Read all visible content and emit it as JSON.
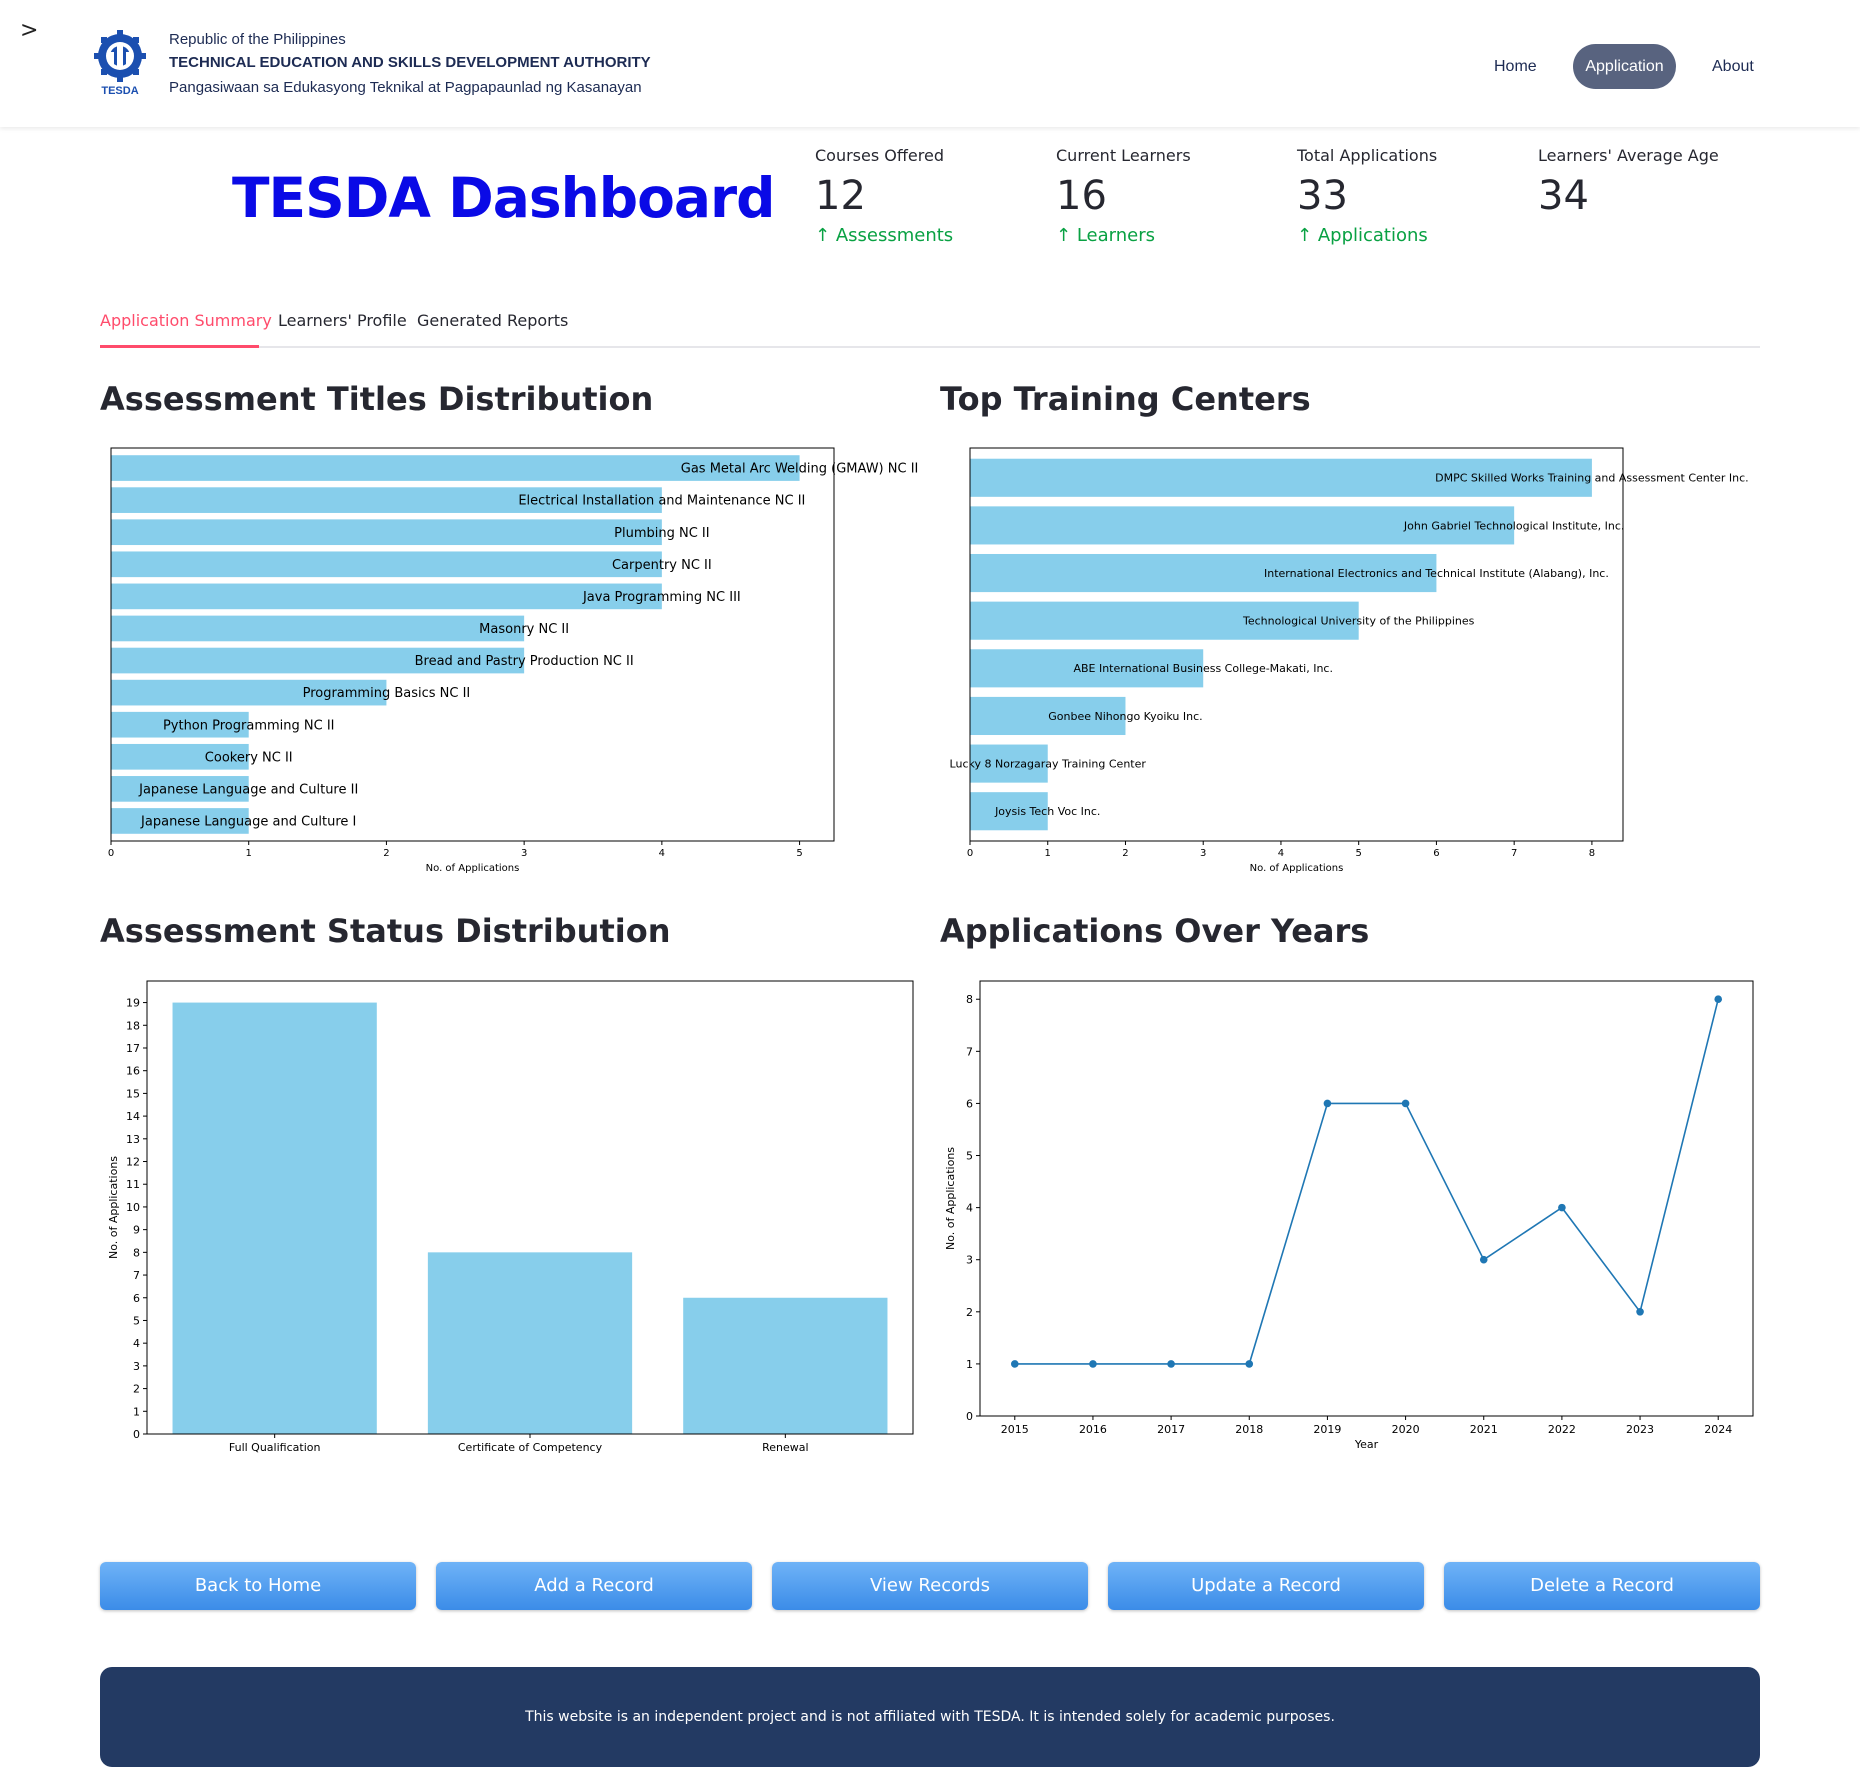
{
  "header": {
    "line1": "Republic of the Philippines",
    "line2": "TECHNICAL EDUCATION AND SKILLS DEVELOPMENT AUTHORITY",
    "line3": "Pangasiwaan sa Edukasyong Teknikal at Pagpapaunlad ng Kasanayan",
    "logo_text": "TESDA",
    "nav": {
      "home": "Home",
      "application": "Application",
      "about": "About"
    },
    "sidebar_toggle": ">"
  },
  "dashboard": {
    "title": "TESDA Dashboard",
    "metrics": [
      {
        "label": "Courses Offered",
        "value": "12",
        "delta": "Assessments"
      },
      {
        "label": "Current Learners",
        "value": "16",
        "delta": "Learners"
      },
      {
        "label": "Total Applications",
        "value": "33",
        "delta": "Applications"
      },
      {
        "label": "Learners' Average Age",
        "value": "34",
        "delta": ""
      }
    ],
    "delta_arrow": "↑"
  },
  "tabs": [
    "Application Summary",
    "Learners' Profile",
    "Generated Reports"
  ],
  "sections": {
    "assessment_titles": "Assessment Titles Distribution",
    "training_centers": "Top Training Centers",
    "assessment_status": "Assessment Status Distribution",
    "applications_years": "Applications Over Years"
  },
  "colors": {
    "bar": "#87ceeb",
    "line": "#1f77b4",
    "accent": "#ff4b6b",
    "title": "#0a0ae6",
    "delta": "#09a143",
    "footer": "#233a63"
  },
  "chart_data": [
    {
      "type": "bar",
      "orientation": "horizontal",
      "categories": [
        "Gas Metal Arc Welding (GMAW) NC II",
        "Electrical Installation and Maintenance NC II",
        "Plumbing NC II",
        "Carpentry NC II",
        "Java Programming NC III",
        "Masonry NC II",
        "Bread and Pastry Production NC II",
        "Programming Basics NC II",
        "Python Programming NC II",
        "Cookery NC II",
        "Japanese Language and Culture II",
        "Japanese Language and Culture I"
      ],
      "values": [
        5,
        4,
        4,
        4,
        4,
        3,
        3,
        2,
        1,
        1,
        1,
        1
      ],
      "xlabel": "No. of Applications",
      "xlim": [
        0,
        5.25
      ],
      "xticks": [
        "0",
        "1",
        "2",
        "3",
        "4",
        "5"
      ]
    },
    {
      "type": "bar",
      "orientation": "horizontal",
      "categories": [
        "DMPC Skilled Works Training and Assessment Center Inc.",
        "John Gabriel Technological Institute, Inc.",
        "International Electronics and Technical Institute (Alabang), Inc.",
        "Technological University of the Philippines",
        "ABE International Business College-Makati, Inc.",
        "Gonbee Nihongo Kyoiku Inc.",
        "Lucky 8 Norzagaray Training Center",
        "Joysis Tech Voc Inc."
      ],
      "values": [
        8,
        7,
        6,
        5,
        3,
        2,
        1,
        1
      ],
      "xlabel": "No. of Applications",
      "xlim": [
        0,
        8.4
      ],
      "xticks": [
        "0",
        "1",
        "2",
        "3",
        "4",
        "5",
        "6",
        "7",
        "8"
      ]
    },
    {
      "type": "bar",
      "categories": [
        "Full Qualification",
        "Certificate of Competency",
        "Renewal"
      ],
      "values": [
        19,
        8,
        6
      ],
      "ylabel": "No. of Applications",
      "ylim": [
        0,
        19.95
      ],
      "yticks": [
        "0",
        "1",
        "2",
        "3",
        "4",
        "5",
        "6",
        "7",
        "8",
        "9",
        "10",
        "11",
        "12",
        "13",
        "14",
        "15",
        "16",
        "17",
        "18",
        "19"
      ]
    },
    {
      "type": "line",
      "x": [
        "2015",
        "2016",
        "2017",
        "2018",
        "2019",
        "2020",
        "2021",
        "2022",
        "2023",
        "2024"
      ],
      "values": [
        1,
        1,
        1,
        1,
        6,
        6,
        3,
        4,
        2,
        8
      ],
      "xlabel": "Year",
      "ylabel": "No. of Applications",
      "ylim": [
        0,
        8.35
      ],
      "yticks": [
        "0",
        "1",
        "2",
        "3",
        "4",
        "5",
        "6",
        "7",
        "8"
      ]
    }
  ],
  "buttons": [
    "Back to Home",
    "Add a Record",
    "View Records",
    "Update a Record",
    "Delete a Record"
  ],
  "footer": {
    "text": "This website is an independent project and is not affiliated with TESDA. It is intended solely for academic purposes."
  }
}
